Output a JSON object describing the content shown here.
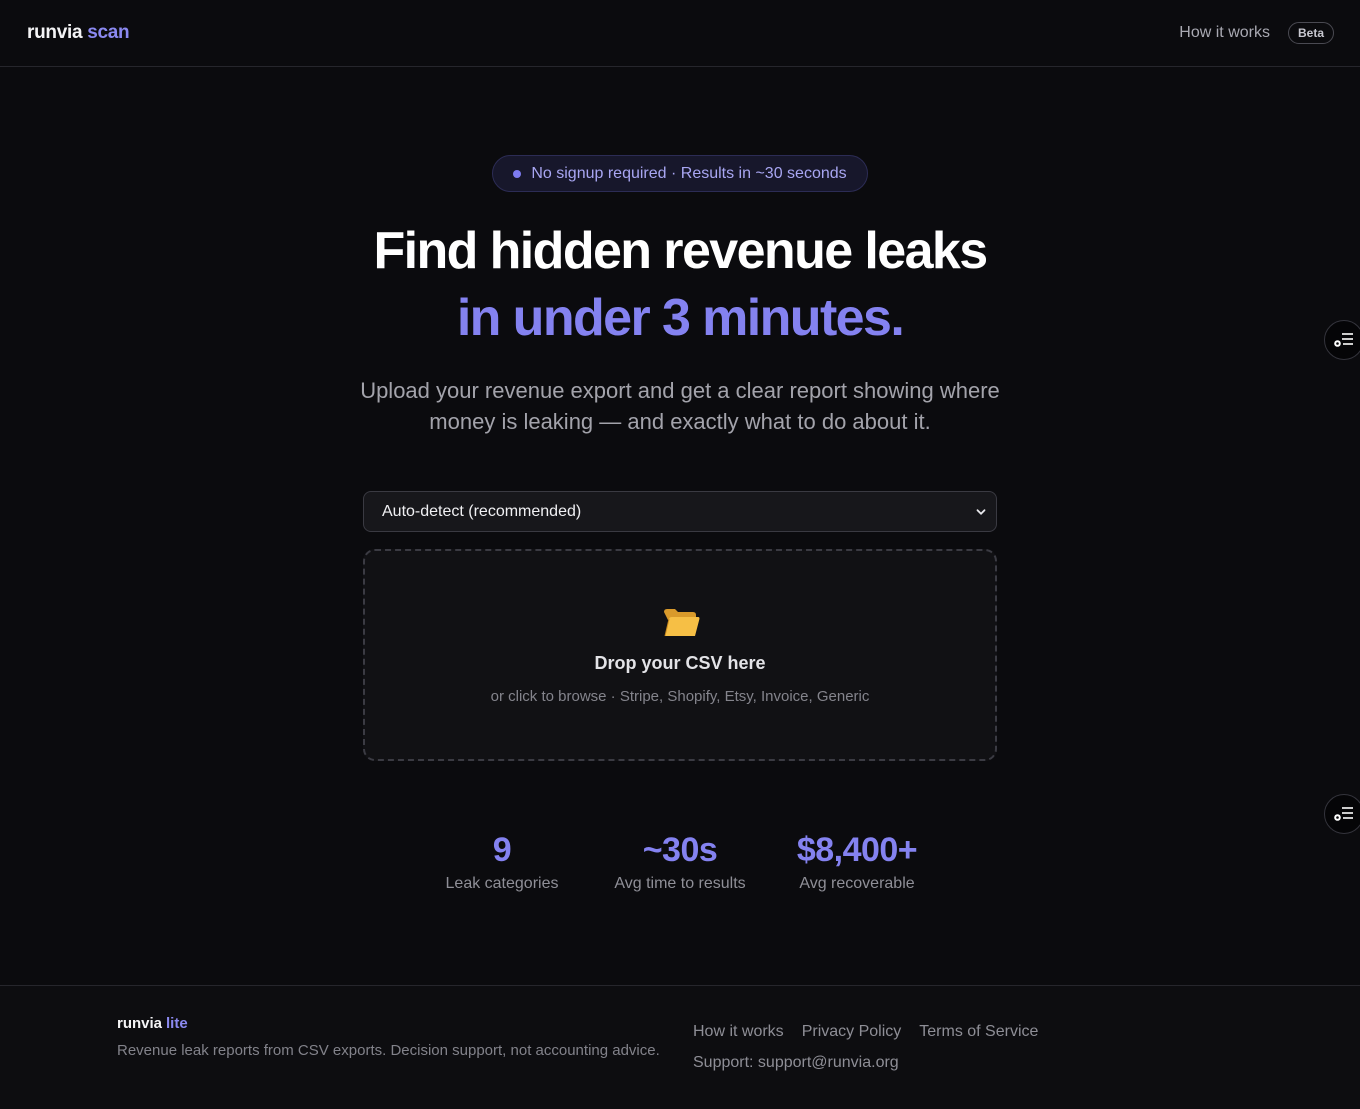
{
  "header": {
    "brand_main": "runvia",
    "brand_accent": "scan",
    "nav_how": "How it works",
    "badge": "Beta"
  },
  "hero": {
    "pill": "No signup required · Results in ~30 seconds",
    "title_line1": "Find hidden revenue leaks",
    "title_line2": "in under 3 minutes.",
    "subtitle": "Upload your revenue export and get a clear report showing where money is leaking — and exactly what to do about it."
  },
  "select": {
    "value": "Auto-detect (recommended)"
  },
  "dropzone": {
    "icon": "folder-open-icon",
    "title": "Drop your CSV here",
    "subtitle": "or click to browse · Stripe, Shopify, Etsy, Invoice, Generic"
  },
  "stats": [
    {
      "value": "9",
      "label": "Leak categories"
    },
    {
      "value": "~30s",
      "label": "Avg time to results"
    },
    {
      "value": "$8,400+",
      "label": "Avg recoverable"
    }
  ],
  "footer": {
    "brand_main": "runvia",
    "brand_accent": "lite",
    "description": "Revenue leak reports from CSV exports. Decision support, not accounting advice.",
    "links": [
      "How it works",
      "Privacy Policy",
      "Terms of Service"
    ],
    "support": "Support: support@runvia.org"
  },
  "colors": {
    "background": "#0b0b0e",
    "accent": "#8482f0",
    "text": "#ffffff",
    "muted": "#a3a3ab"
  }
}
